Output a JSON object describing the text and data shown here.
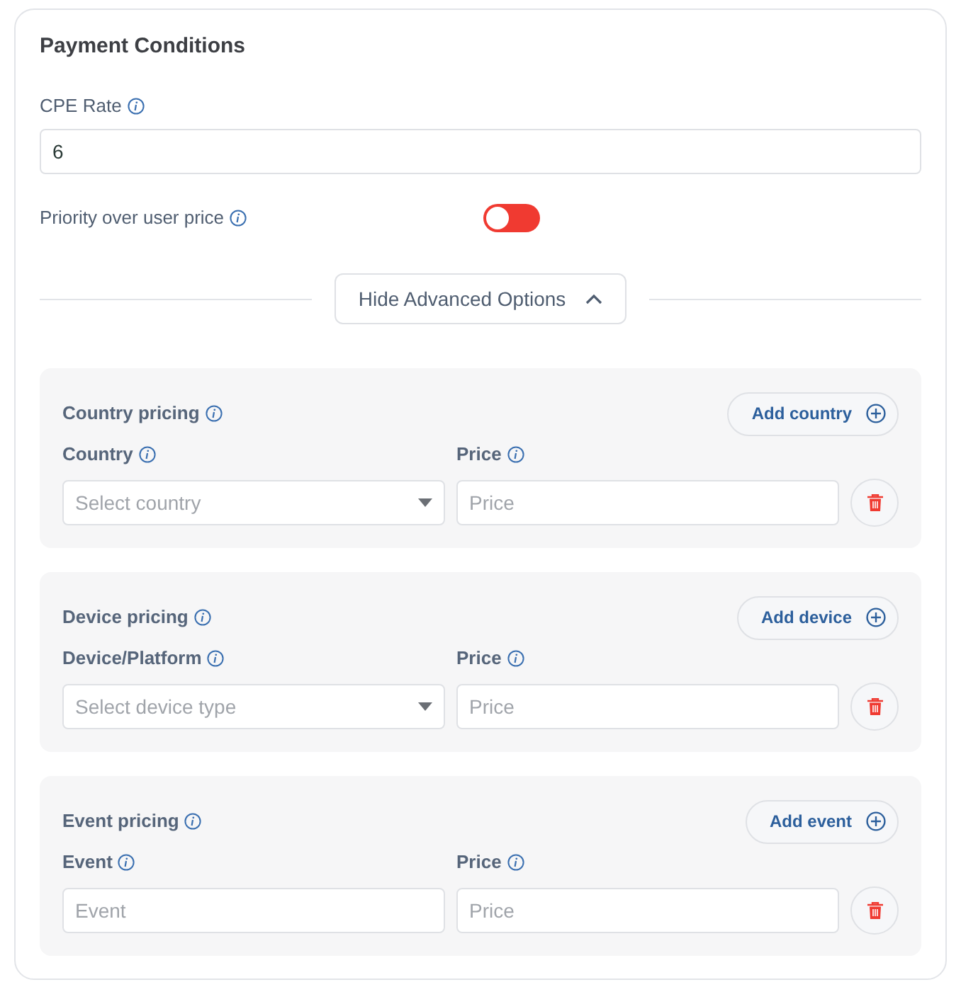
{
  "title": "Payment Conditions",
  "cpe_rate": {
    "label": "CPE Rate",
    "value": "6"
  },
  "priority": {
    "label": "Priority over user price",
    "on": false
  },
  "advanced_toggle": {
    "label": "Hide Advanced Options",
    "expanded": true
  },
  "sections": [
    {
      "title": "Country pricing",
      "add_button": "Add country",
      "fields": [
        {
          "label": "Country",
          "kind": "select",
          "placeholder": "Select country"
        },
        {
          "label": "Price",
          "kind": "input",
          "placeholder": "Price"
        }
      ]
    },
    {
      "title": "Device pricing",
      "add_button": "Add device",
      "fields": [
        {
          "label": "Device/Platform",
          "kind": "select",
          "placeholder": "Select device type"
        },
        {
          "label": "Price",
          "kind": "input",
          "placeholder": "Price"
        }
      ]
    },
    {
      "title": "Event pricing",
      "add_button": "Add event",
      "fields": [
        {
          "label": "Event",
          "kind": "input",
          "placeholder": "Event"
        },
        {
          "label": "Price",
          "kind": "input",
          "placeholder": "Price"
        }
      ]
    }
  ]
}
